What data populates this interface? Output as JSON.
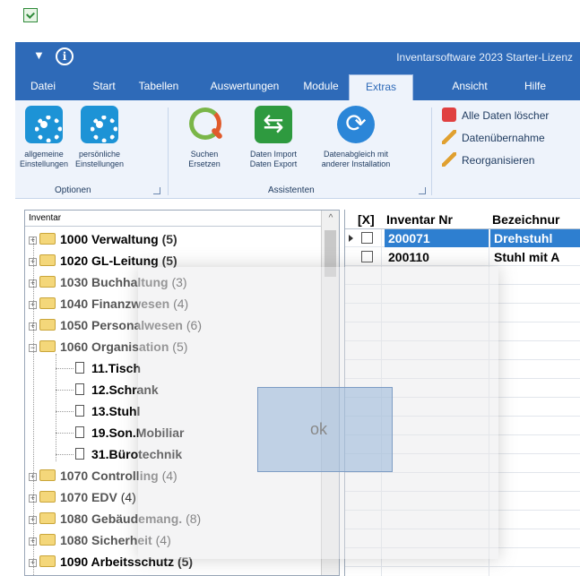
{
  "window": {
    "title": "Inventarsoftware 2023 Starter-Lizenz"
  },
  "icons": {
    "app": "app-check-icon",
    "quick_access": "dropdown-arrow-icon",
    "info": "info-icon"
  },
  "quick_access": {
    "arrow": "▼",
    "info": "i"
  },
  "menu": {
    "items": [
      "Datei",
      "Start",
      "Tabellen",
      "Auswertungen",
      "Module",
      "Extras",
      "Ansicht",
      "Hilfe"
    ],
    "active": "Extras"
  },
  "ribbon": {
    "optionen": {
      "label": "Optionen",
      "buttons": [
        {
          "line1": "allgemeine",
          "line2": "Einstellungen",
          "icon": "gear-icon"
        },
        {
          "line1": "persönliche",
          "line2": "Einstellungen",
          "icon": "gear-icon"
        }
      ]
    },
    "assistenten": {
      "label": "Assistenten",
      "buttons": [
        {
          "line1": "Suchen",
          "line2": "Ersetzen",
          "icon": "search-replace-icon"
        },
        {
          "line1": "Daten Import",
          "line2": "Daten Export",
          "icon": "exchange-icon"
        },
        {
          "line1": "Datenabgleich mit",
          "line2": "anderer Installation",
          "icon": "sync-icon"
        }
      ]
    },
    "small_buttons": [
      {
        "label": "Alle Daten löscher",
        "icon": "delete-icon"
      },
      {
        "label": "Datenübernahme",
        "icon": "pencil-icon"
      },
      {
        "label": "Reorganisieren",
        "icon": "pencil-icon"
      }
    ]
  },
  "tree": {
    "header": "Inventar",
    "scroll_up": "^",
    "items": [
      {
        "code": "1000 Verwaltung",
        "count": "(5)",
        "type": "folder",
        "expanded": false
      },
      {
        "code": "1020 GL-Leitung",
        "count": "(5)",
        "type": "folder",
        "expanded": false
      },
      {
        "code": "1030 Buchhaltung",
        "count": "(3)",
        "type": "folder",
        "expanded": false
      },
      {
        "code": "1040 Finanzwesen",
        "count": "(4)",
        "type": "folder",
        "expanded": false
      },
      {
        "code": "1050 Personalwesen",
        "count": "(6)",
        "type": "folder",
        "expanded": false
      },
      {
        "code": "1060 Organisation",
        "count": "(5)",
        "type": "folder",
        "expanded": true
      },
      {
        "code": "11.Tisch",
        "count": "",
        "type": "doc"
      },
      {
        "code": "12.Schrank",
        "count": "",
        "type": "doc"
      },
      {
        "code": "13.Stuhl",
        "count": "",
        "type": "doc"
      },
      {
        "code": "19.Son.Mobiliar",
        "count": "",
        "type": "doc"
      },
      {
        "code": "31.Bürotechnik",
        "count": "",
        "type": "doc"
      },
      {
        "code": "1070 Controlling",
        "count": "(4)",
        "type": "folder",
        "expanded": false
      },
      {
        "code": "1070 EDV",
        "count": "(4)",
        "type": "folder",
        "expanded": false
      },
      {
        "code": "1080 Gebäudemang.",
        "count": "(8)",
        "type": "folder",
        "expanded": false
      },
      {
        "code": "1080 Sicherheit",
        "count": "(4)",
        "type": "folder",
        "expanded": false
      },
      {
        "code": "1090 Arbeitsschutz",
        "count": "(5)",
        "type": "folder",
        "expanded": false
      }
    ]
  },
  "grid": {
    "columns": [
      "[X]",
      "Inventar Nr",
      "Bezeichnur"
    ],
    "rows": [
      {
        "nr": "200071",
        "bez": "Drehstuhl",
        "selected": true
      },
      {
        "nr": "200110",
        "bez": "Stuhl mit A",
        "selected": false
      }
    ]
  },
  "dialog": {
    "ok_label": "ok"
  },
  "colors": {
    "title_blue": "#2e6ab8",
    "ribbon_bg": "#eef3fb",
    "selection": "#2e7fd0",
    "icon_blue": "#1d93d6",
    "icon_green": "#2e9a3f"
  }
}
